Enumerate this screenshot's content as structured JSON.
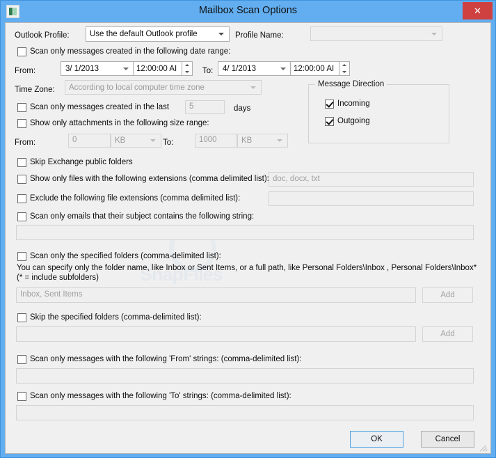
{
  "window": {
    "title": "Mailbox Scan Options",
    "icon": "app-window-icon",
    "close_label": "✕",
    "accent_color": "#62aef0",
    "close_color": "#cf4040"
  },
  "profile": {
    "outlook_profile_label": "Outlook Profile:",
    "outlook_profile_value": "Use the default Outlook profile",
    "profile_name_label": "Profile Name:",
    "profile_name_value": ""
  },
  "date_range": {
    "checkbox_label": "Scan only messages created in the following date range:",
    "checked": false,
    "from_label": "From:",
    "from_date": "3/ 1/2013",
    "from_time": "12:00:00 AI",
    "to_label": "To:",
    "to_date": "4/ 1/2013",
    "to_time": "12:00:00 AI"
  },
  "time_zone": {
    "label": "Time Zone:",
    "value": "According to local computer time zone"
  },
  "last_days": {
    "checkbox_label": "Scan only messages created in the last",
    "checked": false,
    "value": "5",
    "unit_label": "days"
  },
  "size_range": {
    "checkbox_label": "Show only attachments in the following size range:",
    "checked": false,
    "from_label": "From:",
    "from_value": "0",
    "from_unit": "KB",
    "to_label": "To:",
    "to_value": "1000",
    "to_unit": "KB"
  },
  "message_direction": {
    "title": "Message Direction",
    "incoming_label": "Incoming",
    "incoming_checked": true,
    "outgoing_label": "Outgoing",
    "outgoing_checked": true
  },
  "skip_public_folders": {
    "checkbox_label": "Skip Exchange public folders",
    "checked": false
  },
  "include_extensions": {
    "checkbox_label": "Show only files with the following extensions (comma delimited list):",
    "checked": false,
    "placeholder": "doc, docx, txt",
    "value": ""
  },
  "exclude_extensions": {
    "checkbox_label": "Exclude the following file extensions (comma delimited list):",
    "checked": false,
    "value": ""
  },
  "subject_contains": {
    "checkbox_label": "Scan only emails that their subject contains the following string:",
    "checked": false,
    "value": ""
  },
  "specified_folders": {
    "checkbox_label": "Scan only the specified folders (comma-delimited list):",
    "checked": false,
    "hint_line1": "You can specify only the folder name, like Inbox or Sent Items, or a full path, like Personal Folders\\Inbox , Personal Folders\\Inbox*",
    "hint_line2": " (* = include subfolders)",
    "placeholder": "Inbox, Sent Items",
    "value": "",
    "add_label": "Add"
  },
  "skip_folders": {
    "checkbox_label": "Skip the specified folders (comma-delimited list):",
    "checked": false,
    "value": "",
    "add_label": "Add"
  },
  "from_strings": {
    "checkbox_label": "Scan only messages with the following 'From' strings: (comma-delimited list):",
    "checked": false,
    "value": ""
  },
  "to_strings": {
    "checkbox_label": "Scan only messages with the following 'To' strings: (comma-delimited list):",
    "checked": false,
    "value": ""
  },
  "footer": {
    "ok_label": "OK",
    "cancel_label": "Cancel"
  },
  "watermark": {
    "text": "SnapFiles"
  }
}
